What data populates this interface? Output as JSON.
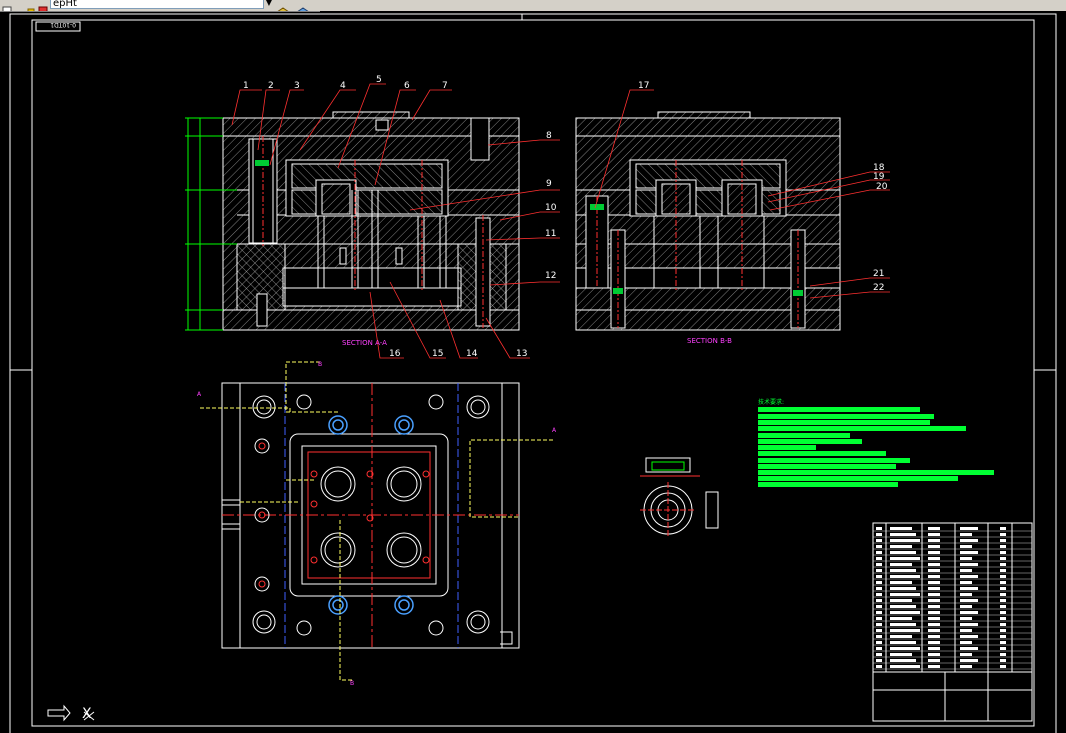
{
  "toolbar": {
    "layer_value": "epHt",
    "icons": [
      "layer-manager-icon",
      "lock-icon",
      "color-swatch-icon",
      "dropdown-icon",
      "layer-previous-icon",
      "layer-states-icon"
    ]
  },
  "drawing": {
    "sheet_code": "0-10TD1",
    "section_aa": "SECTION A-A",
    "section_bb": "SECTION B-B",
    "part_numbers_top": [
      "1",
      "2",
      "3",
      "4",
      "5",
      "6",
      "7"
    ],
    "part_numbers_right": [
      "8",
      "9",
      "10",
      "11",
      "12"
    ],
    "part_numbers_bottom": [
      "16",
      "15",
      "14",
      "13"
    ],
    "part_17": "17",
    "part_numbers_bb_right": [
      "18",
      "19",
      "20"
    ],
    "part_numbers_bb_lower": [
      "21",
      "22"
    ],
    "section_marks": {
      "a": "A",
      "b": "B"
    },
    "tech_title": "技术要求:",
    "ucs_axis": "X"
  },
  "colors": {
    "background": "#000000",
    "line_white": "#ffffff",
    "hatch": "#c8c8c8",
    "label_magenta": "#ff40ff",
    "leader_red": "#ff3030",
    "dim_green": "#00ff00",
    "tech_green": "#00ff33",
    "centerline_yellow": "#ffff60",
    "hidden_blue": "#4060ff",
    "bolt_blue": "#4aa0ff"
  }
}
